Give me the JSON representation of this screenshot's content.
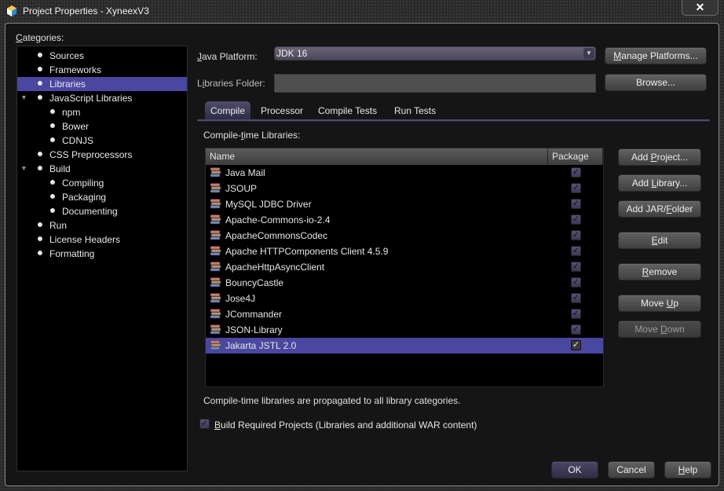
{
  "window": {
    "title": "Project Properties - XyneexV3",
    "close_label": "✕"
  },
  "categories": {
    "label": "Categories:",
    "items": [
      {
        "label": "Sources",
        "level": 0,
        "expandable": false,
        "selected": false
      },
      {
        "label": "Frameworks",
        "level": 0,
        "expandable": false,
        "selected": false
      },
      {
        "label": "Libraries",
        "level": 0,
        "expandable": false,
        "selected": true
      },
      {
        "label": "JavaScript Libraries",
        "level": 0,
        "expandable": true,
        "selected": false
      },
      {
        "label": "npm",
        "level": 1,
        "expandable": false,
        "selected": false
      },
      {
        "label": "Bower",
        "level": 1,
        "expandable": false,
        "selected": false
      },
      {
        "label": "CDNJS",
        "level": 1,
        "expandable": false,
        "selected": false
      },
      {
        "label": "CSS Preprocessors",
        "level": 0,
        "expandable": false,
        "selected": false
      },
      {
        "label": "Build",
        "level": 0,
        "expandable": true,
        "selected": false
      },
      {
        "label": "Compiling",
        "level": 1,
        "expandable": false,
        "selected": false
      },
      {
        "label": "Packaging",
        "level": 1,
        "expandable": false,
        "selected": false
      },
      {
        "label": "Documenting",
        "level": 1,
        "expandable": false,
        "selected": false
      },
      {
        "label": "Run",
        "level": 0,
        "expandable": false,
        "selected": false
      },
      {
        "label": "License Headers",
        "level": 0,
        "expandable": false,
        "selected": false
      },
      {
        "label": "Formatting",
        "level": 0,
        "expandable": false,
        "selected": false
      }
    ]
  },
  "platform": {
    "label": "Java Platform:",
    "value": "JDK 16",
    "manage_button": "Manage Platforms..."
  },
  "libraries_folder": {
    "label": "Libraries Folder:",
    "value": "",
    "browse_button": "Browse..."
  },
  "tabs": [
    {
      "label": "Compile",
      "active": true
    },
    {
      "label": "Processor",
      "active": false
    },
    {
      "label": "Compile Tests",
      "active": false
    },
    {
      "label": "Run Tests",
      "active": false
    }
  ],
  "compile": {
    "label": "Compile-time Libraries:",
    "columns": [
      "Name",
      "Package"
    ],
    "rows": [
      {
        "name": "Java Mail",
        "package": true,
        "selected": false
      },
      {
        "name": "JSOUP",
        "package": true,
        "selected": false
      },
      {
        "name": "MySQL JDBC Driver",
        "package": true,
        "selected": false
      },
      {
        "name": "Apache-Commons-io-2.4",
        "package": true,
        "selected": false
      },
      {
        "name": "ApacheCommonsCodec",
        "package": true,
        "selected": false
      },
      {
        "name": "Apache HTTPComponents Client 4.5.9",
        "package": true,
        "selected": false
      },
      {
        "name": "ApacheHttpAsyncClient",
        "package": true,
        "selected": false
      },
      {
        "name": "BouncyCastle",
        "package": true,
        "selected": false
      },
      {
        "name": "Jose4J",
        "package": true,
        "selected": false
      },
      {
        "name": "JCommander",
        "package": true,
        "selected": false
      },
      {
        "name": "JSON-Library",
        "package": true,
        "selected": false
      },
      {
        "name": "Jakarta JSTL 2.0",
        "package": true,
        "selected": true
      }
    ],
    "note": "Compile-time libraries are propagated to all library categories.",
    "buttons": {
      "add_project": "Add Project...",
      "add_library": "Add Library...",
      "add_jar": "Add JAR/Folder",
      "edit": "Edit",
      "remove": "Remove",
      "move_up": "Move Up",
      "move_down": "Move Down"
    }
  },
  "build_required": {
    "label": "Build Required Projects (Libraries and additional WAR content)",
    "checked": true
  },
  "footer": {
    "ok": "OK",
    "cancel": "Cancel",
    "help": "Help"
  },
  "colors": {
    "selection": "#4a47a0",
    "accent_rule": "#4a4b78",
    "background": "#151515"
  }
}
